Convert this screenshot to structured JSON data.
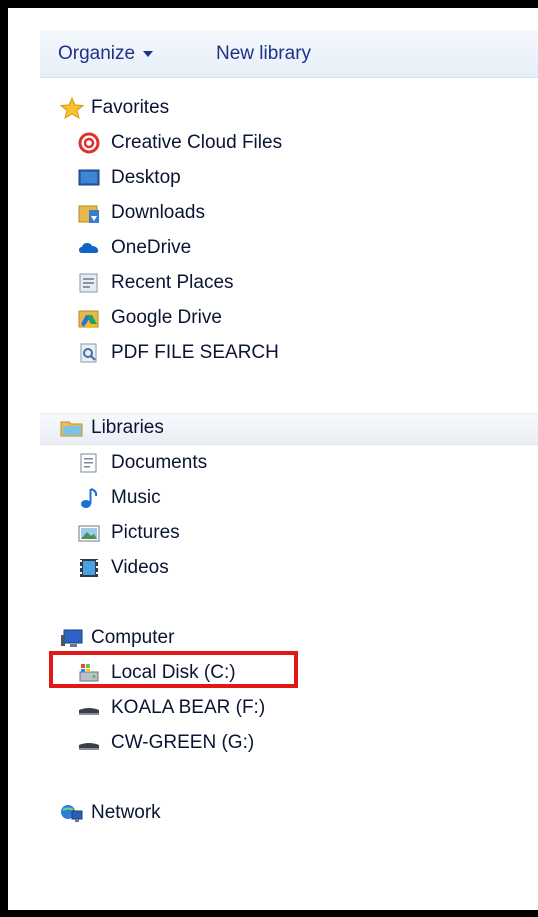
{
  "toolbar": {
    "organize_label": "Organize",
    "new_library_label": "New library"
  },
  "favorites": {
    "label": "Favorites",
    "items": [
      {
        "label": "Creative Cloud Files",
        "icon": "creative-cloud-icon"
      },
      {
        "label": "Desktop",
        "icon": "desktop-icon"
      },
      {
        "label": "Downloads",
        "icon": "downloads-icon"
      },
      {
        "label": "OneDrive",
        "icon": "onedrive-icon"
      },
      {
        "label": "Recent Places",
        "icon": "recent-places-icon"
      },
      {
        "label": "Google Drive",
        "icon": "google-drive-icon"
      },
      {
        "label": "PDF FILE SEARCH",
        "icon": "pdf-search-icon"
      }
    ]
  },
  "libraries": {
    "label": "Libraries",
    "items": [
      {
        "label": "Documents",
        "icon": "documents-icon"
      },
      {
        "label": "Music",
        "icon": "music-icon"
      },
      {
        "label": "Pictures",
        "icon": "pictures-icon"
      },
      {
        "label": "Videos",
        "icon": "videos-icon"
      }
    ]
  },
  "computer": {
    "label": "Computer",
    "items": [
      {
        "label": "Local Disk (C:)",
        "icon": "local-disk-icon",
        "highlighted": true
      },
      {
        "label": "KOALA BEAR (F:)",
        "icon": "removable-drive-icon"
      },
      {
        "label": "CW-GREEN (G:)",
        "icon": "removable-drive-icon"
      }
    ]
  },
  "network": {
    "label": "Network"
  },
  "colors": {
    "highlight": "#e01818",
    "toolbar_text": "#1e3287"
  }
}
